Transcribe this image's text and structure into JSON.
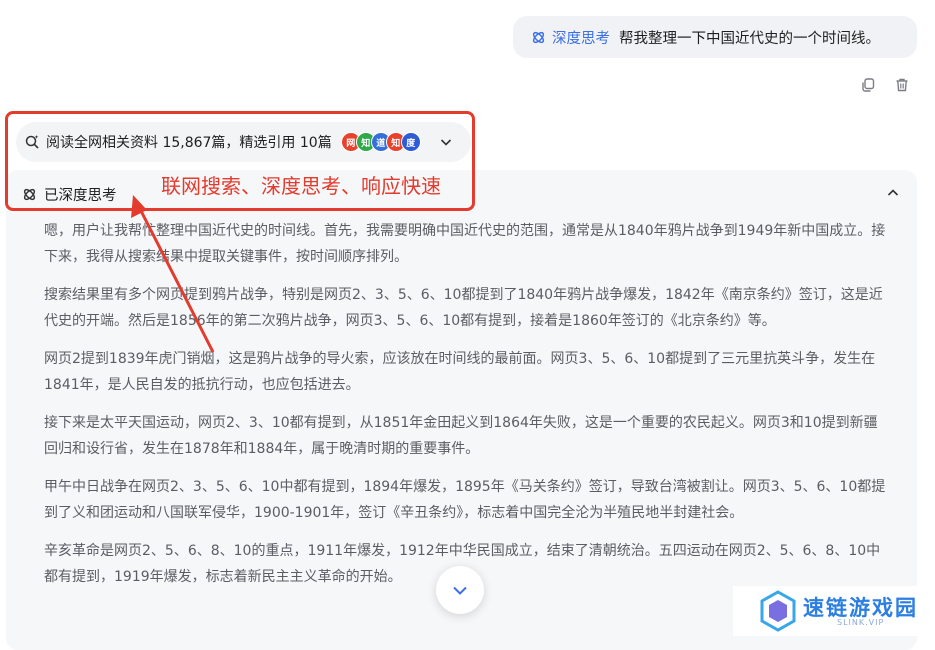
{
  "user_message": {
    "tag_label": "深度思考",
    "text": "帮我整理一下中国近代史的一个时间线。"
  },
  "message_actions": {
    "copy_icon": "copy-icon",
    "delete_icon": "trash-icon"
  },
  "search_summary": {
    "text": "阅读全网相关资料 15,867篇，精选引用 10篇",
    "sources": [
      {
        "label": "网",
        "color": "#e8412c"
      },
      {
        "label": "知",
        "color": "#2faa4a"
      },
      {
        "label": "道",
        "color": "#3570d8"
      },
      {
        "label": "知",
        "color": "#e8412c"
      },
      {
        "label": "度",
        "color": "#2e5bd6"
      }
    ]
  },
  "thinking": {
    "title": "已深度思考",
    "paragraphs": [
      "嗯，用户让我帮忙整理中国近代史的时间线。首先，我需要明确中国近代史的范围，通常是从1840年鸦片战争到1949年新中国成立。接下来，我得从搜索结果中提取关键事件，按时间顺序排列。",
      "搜索结果里有多个网页提到鸦片战争，特别是网页2、3、5、6、10都提到了1840年鸦片战争爆发，1842年《南京条约》签订，这是近代史的开端。然后是1856年的第二次鸦片战争，网页3、5、6、10都有提到，接着是1860年签订的《北京条约》等。",
      "网页2提到1839年虎门销烟，这是鸦片战争的导火索，应该放在时间线的最前面。网页3、5、6、10都提到了三元里抗英斗争，发生在1841年，是人民自发的抵抗行动，也应包括进去。",
      "接下来是太平天国运动，网页2、3、10都有提到，从1851年金田起义到1864年失败，这是一个重要的农民起义。网页3和10提到新疆回归和设行省，发生在1878年和1884年，属于晚清时期的重要事件。",
      "甲午中日战争在网页2、3、5、6、10中都有提到，1894年爆发，1895年《马关条约》签订，导致台湾被割让。网页3、5、6、10都提到了义和团运动和八国联军侵华，1900-1901年，签订《辛丑条约》，标志着中国完全沦为半殖民地半封建社会。",
      "辛亥革命是网页2、5、6、8、10的重点，1911年爆发，1912年中华民国成立，结束了清朝统治。五四运动在网页2、5、6、8、10中都有提到，1919年爆发，标志着新民主主义革命的开始。"
    ]
  },
  "annotation": {
    "text": "联网搜索、深度思考、响应快速",
    "color": "#e33b2d"
  },
  "watermark": {
    "text": "速链游戏园",
    "subtext": "SLINK.VIP"
  }
}
